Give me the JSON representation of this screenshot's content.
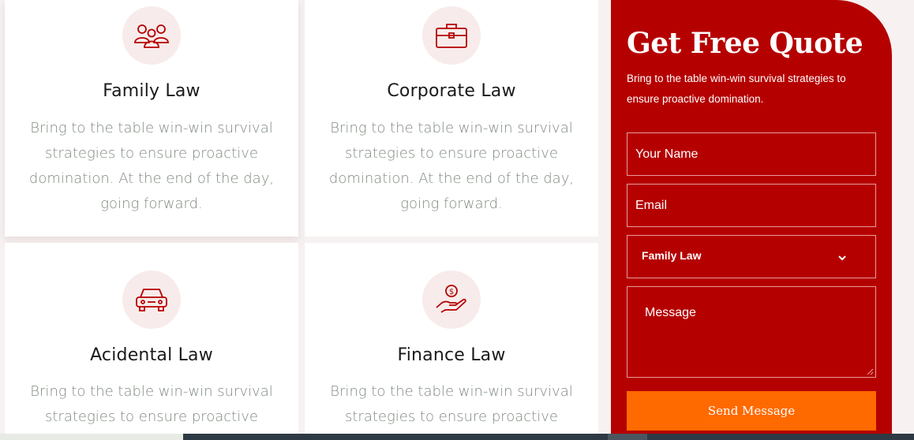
{
  "services": [
    {
      "title": "Family Law",
      "desc_lines": [
        "Bring to the table win-win survival",
        "strategies to ensure proactive",
        "domination. At the end of the day,",
        "going forward."
      ],
      "icon": "family-icon"
    },
    {
      "title": "Corporate Law",
      "desc_lines": [
        "Bring to the table win-win survival",
        "strategies to ensure proactive",
        "domination. At the end of the day,",
        "going forward."
      ],
      "icon": "briefcase-icon"
    },
    {
      "title": "Acidental Law",
      "desc_lines": [
        "Bring to the table win-win survival",
        "strategies to ensure proactive"
      ],
      "icon": "car-icon"
    },
    {
      "title": "Finance Law",
      "desc_lines": [
        "Bring to the table win-win survival",
        "strategies to ensure proactive"
      ],
      "icon": "money-hand-icon"
    }
  ],
  "quote": {
    "title": "Get Free Quote",
    "subtitle_lines": [
      "Bring to the table win-win survival strategies to",
      "ensure proactive domination."
    ],
    "name_placeholder": "Your Name",
    "email_placeholder": "Email",
    "service_selected": "Family Law",
    "message_placeholder": "Message",
    "send_label": "Send Message"
  },
  "colors": {
    "brand_red": "#b50000",
    "accent_orange": "#ff6a00",
    "icon_red": "#b50000"
  }
}
